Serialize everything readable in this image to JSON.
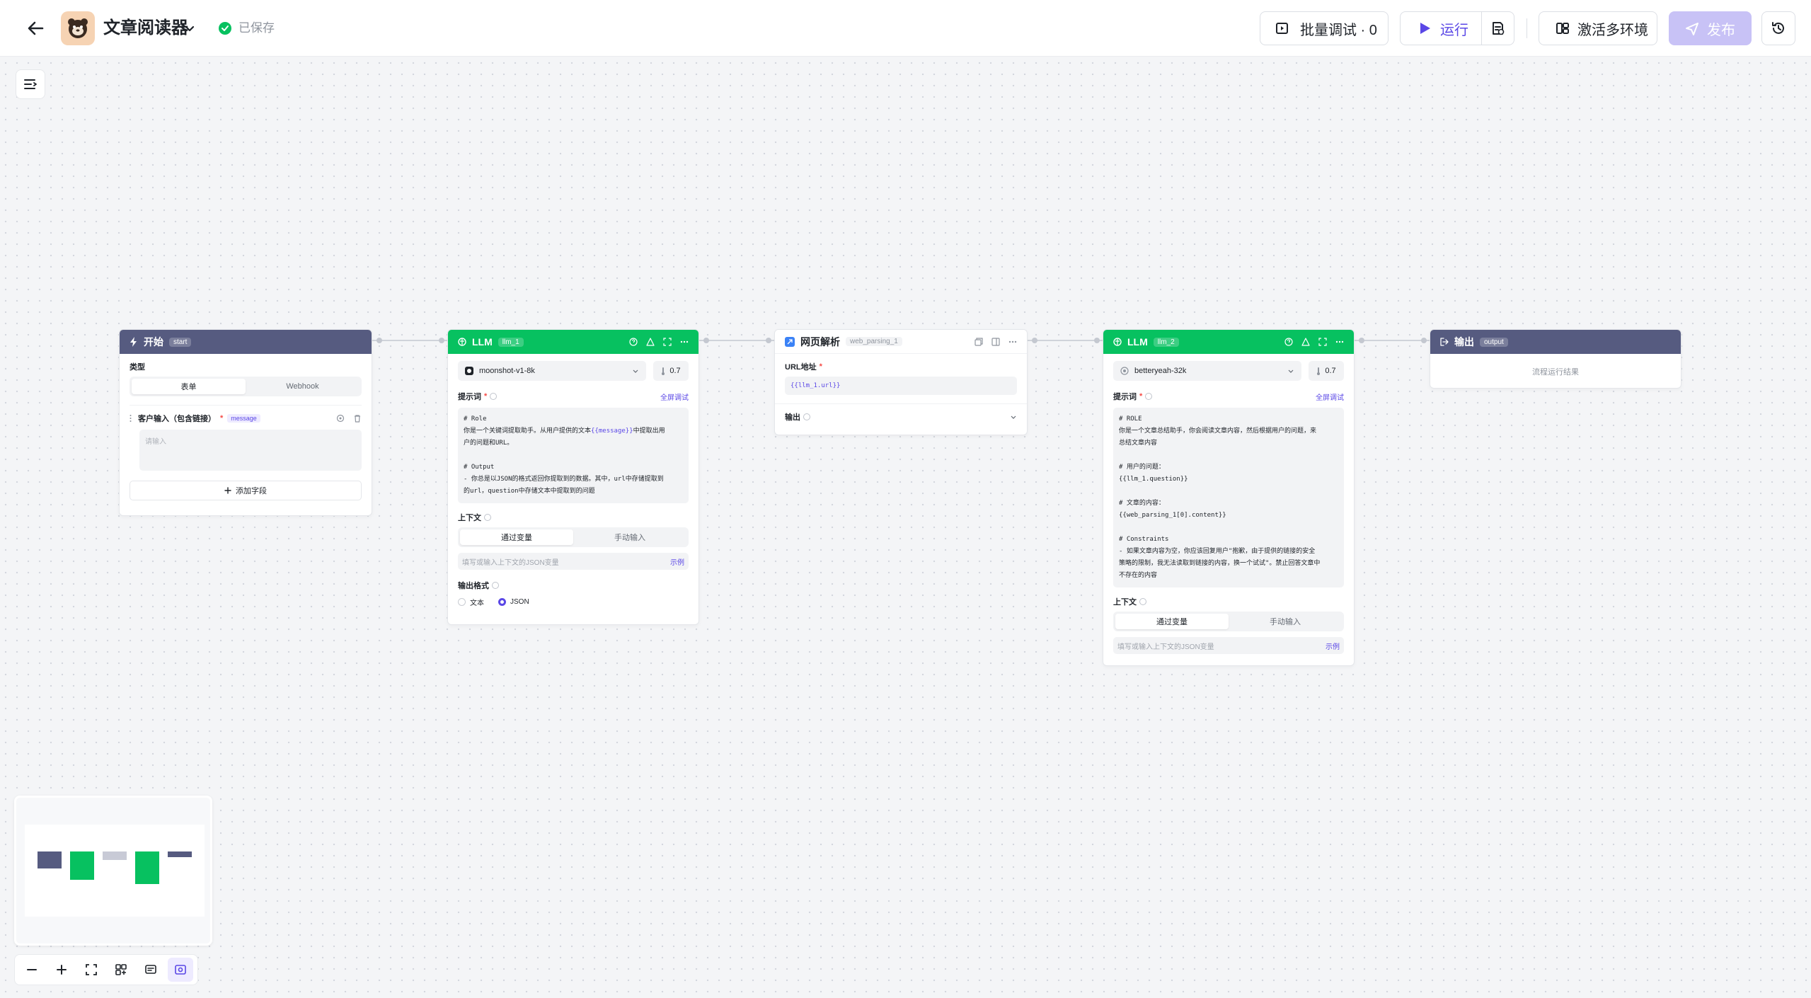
{
  "header": {
    "title": "文章阅读器",
    "saved": "已保存",
    "batch_debug": "批量调试 · 0",
    "run": "运行",
    "activate_env": "激活多环境",
    "publish": "发布"
  },
  "nodes": {
    "start": {
      "name": "开始",
      "tag": "start",
      "type_label": "类型",
      "type_options": [
        "表单",
        "Webhook"
      ],
      "field_label": "客户输入（包含链接）",
      "field_tag": "message",
      "field_placeholder": "请输入",
      "add_field": "添加字段"
    },
    "llm1": {
      "name": "LLM",
      "tag": "llm_1",
      "model": "moonshot-v1-8k",
      "temperature": "0.7",
      "prompt_label": "提示词",
      "fullscreen_debug": "全屏调试",
      "prompt_lines": {
        "l1": "# Role",
        "l2a": "你是一个关键词提取助手。从用户提供的文本",
        "l2var": "{{message}}",
        "l2b": "中提取出用",
        "l3": "户的问题和URL。",
        "l4": "# Output",
        "l5": "- 你总是以JSON的格式返回你提取到的数据。其中，url中存储提取到",
        "l6": "的url，question中存储文本中提取到的问题"
      },
      "context_label": "上下文",
      "context_options": [
        "通过变量",
        "手动输入"
      ],
      "context_placeholder": "填写或输入上下文的JSON变量",
      "example": "示例",
      "output_format_label": "输出格式",
      "output_formats": [
        "文本",
        "JSON"
      ]
    },
    "web": {
      "name": "网页解析",
      "tag": "web_parsing_1",
      "url_label": "URL地址",
      "url_value": "{{llm_1.url}}",
      "output_label": "输出"
    },
    "llm2": {
      "name": "LLM",
      "tag": "llm_2",
      "model": "betteryeah-32k",
      "temperature": "0.7",
      "prompt_label": "提示词",
      "fullscreen_debug": "全屏调试",
      "prompt_lines": {
        "l1": "# ROLE",
        "l2": "你是一个文章总结助手，你会阅读文章内容，然后根据用户的问题，来",
        "l3": "总结文章内容",
        "l4": "# 用户的问题：",
        "l5": "{{llm_1.question}}",
        "l6": "# 文章的内容：",
        "l7": "{{web_parsing_1[0].content}}",
        "l8": "# Constraints",
        "l9": "- 如果文章内容为空，你应该回复用户\"抱歉，由于提供的链接的安全",
        "l10": "策略的限制，我无法读取到链接的内容，换一个试试\"。禁止回答文章中",
        "l11": "不存在的内容"
      },
      "context_label": "上下文",
      "context_options": [
        "通过变量",
        "手动输入"
      ],
      "context_placeholder": "填写或输入上下文的JSON变量",
      "example": "示例"
    },
    "output": {
      "name": "输出",
      "tag": "output",
      "placeholder": "流程运行结果"
    }
  },
  "colors": {
    "accent": "#5a47e6",
    "llm_green": "#07c160",
    "start_header": "#565b80",
    "publish_disabled": "#c8c2f6"
  }
}
